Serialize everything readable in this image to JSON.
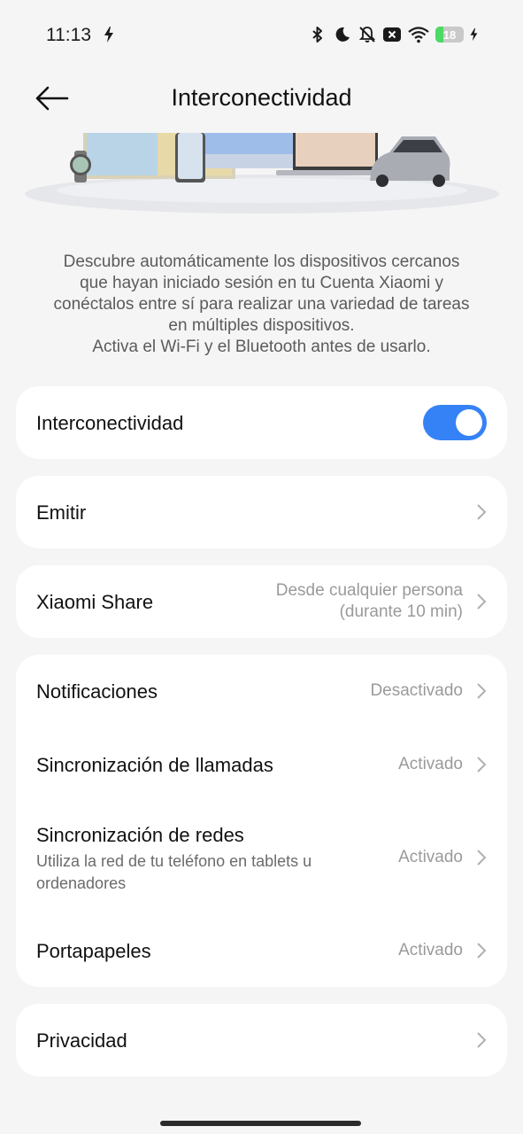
{
  "status": {
    "time": "11:13",
    "battery": "18",
    "icons": [
      "charging-bolt-icon",
      "bluetooth-icon",
      "moon-icon",
      "bell-off-icon",
      "close-box-icon",
      "wifi-icon",
      "battery-icon"
    ]
  },
  "header": {
    "title": "Interconectividad"
  },
  "description": {
    "lines": [
      "Descubre automáticamente los dispositivos cercanos",
      "que hayan iniciado sesión en tu Cuenta Xiaomi y",
      "conéctalos entre sí para realizar una variedad de tareas",
      "en múltiples dispositivos.",
      "Activa el Wi-Fi y el Bluetooth antes de usarlo."
    ]
  },
  "settings": {
    "interconnect": {
      "label": "Interconectividad",
      "on": true
    },
    "cast": {
      "label": "Emitir"
    },
    "share": {
      "label": "Xiaomi Share",
      "value_line1": "Desde cualquier persona",
      "value_line2": "(durante 10 min)"
    },
    "notifications": {
      "label": "Notificaciones",
      "value": "Desactivado"
    },
    "calls": {
      "label": "Sincronización de llamadas",
      "value": "Activado"
    },
    "networks": {
      "label": "Sincronización de redes",
      "sub_line1": "Utiliza la red de tu teléfono en tablets u",
      "sub_line2": "ordenadores",
      "value": "Activado"
    },
    "clipboard": {
      "label": "Portapapeles",
      "value": "Activado"
    },
    "privacy": {
      "label": "Privacidad"
    }
  },
  "colors": {
    "accent": "#3482f6",
    "background": "#f5f5f5",
    "card": "#ffffff"
  }
}
